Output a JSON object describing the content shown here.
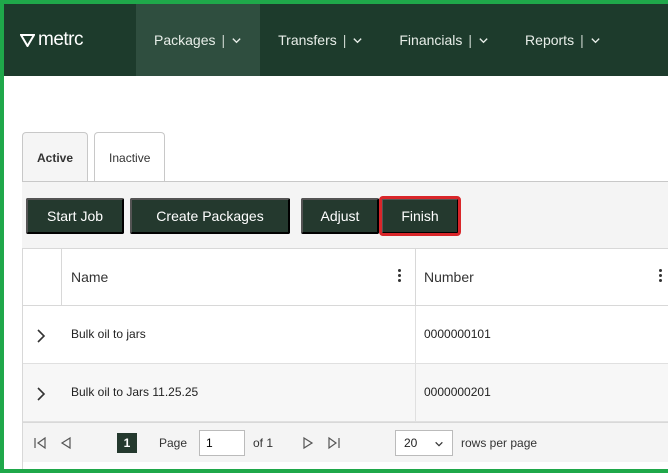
{
  "nav": {
    "logo": "metrc",
    "items": [
      {
        "label": "Packages"
      },
      {
        "label": "Transfers"
      },
      {
        "label": "Financials"
      },
      {
        "label": "Reports"
      }
    ],
    "separator": "|"
  },
  "tabs": [
    {
      "label": "Active"
    },
    {
      "label": "Inactive"
    }
  ],
  "toolbar": {
    "start_job": "Start Job",
    "create_packages": "Create Packages",
    "adjust": "Adjust",
    "finish": "Finish"
  },
  "grid": {
    "columns": [
      {
        "label": "Name"
      },
      {
        "label": "Number"
      }
    ],
    "rows": [
      {
        "name": "Bulk oil to jars",
        "number": "0000000101"
      },
      {
        "name": "Bulk oil to Jars 11.25.25",
        "number": "0000000201"
      }
    ]
  },
  "pager": {
    "current_page": "1",
    "page_label": "Page",
    "page_input": "1",
    "of_label": "of 1",
    "page_size": "20",
    "rows_per_page": "rows per page"
  },
  "colors": {
    "nav_bg": "#1d3b2c",
    "button_bg": "#24392e",
    "frame_border": "#1fa84a",
    "highlight": "#d9262a"
  }
}
